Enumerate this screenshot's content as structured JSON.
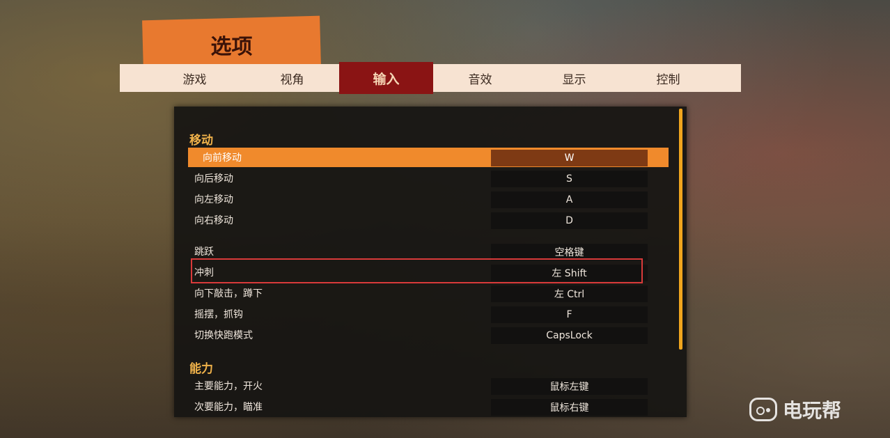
{
  "title": "选项",
  "tabs": [
    {
      "label": "游戏",
      "active": false
    },
    {
      "label": "视角",
      "active": false
    },
    {
      "label": "输入",
      "active": true
    },
    {
      "label": "音效",
      "active": false
    },
    {
      "label": "显示",
      "active": false
    },
    {
      "label": "控制",
      "active": false
    }
  ],
  "sections": [
    {
      "title": "移动",
      "rows": [
        {
          "label": "向前移动",
          "key": "W",
          "selected": true
        },
        {
          "label": "向后移动",
          "key": "S"
        },
        {
          "label": "向左移动",
          "key": "A"
        },
        {
          "label": "向右移动",
          "key": "D"
        },
        {
          "label": "跳跃",
          "key": "空格键"
        },
        {
          "label": "冲刺",
          "key": "左 Shift",
          "highlighted": true
        },
        {
          "label": "向下敲击，蹲下",
          "key": "左 Ctrl"
        },
        {
          "label": "摇摆，抓钩",
          "key": "F"
        },
        {
          "label": "切换快跑模式",
          "key": "CapsLock"
        }
      ]
    },
    {
      "title": "能力",
      "rows": [
        {
          "label": "主要能力，开火",
          "key": "鼠标左键"
        },
        {
          "label": "次要能力，瞄准",
          "key": "鼠标右键"
        }
      ]
    }
  ],
  "watermark": {
    "text": "电玩帮",
    "icon": "gamepad-icon"
  },
  "colors": {
    "accent_orange": "#f08a2c",
    "active_tab": "#8a1414",
    "section_title": "#f0b24a",
    "highlight_frame": "#d93a3a"
  }
}
